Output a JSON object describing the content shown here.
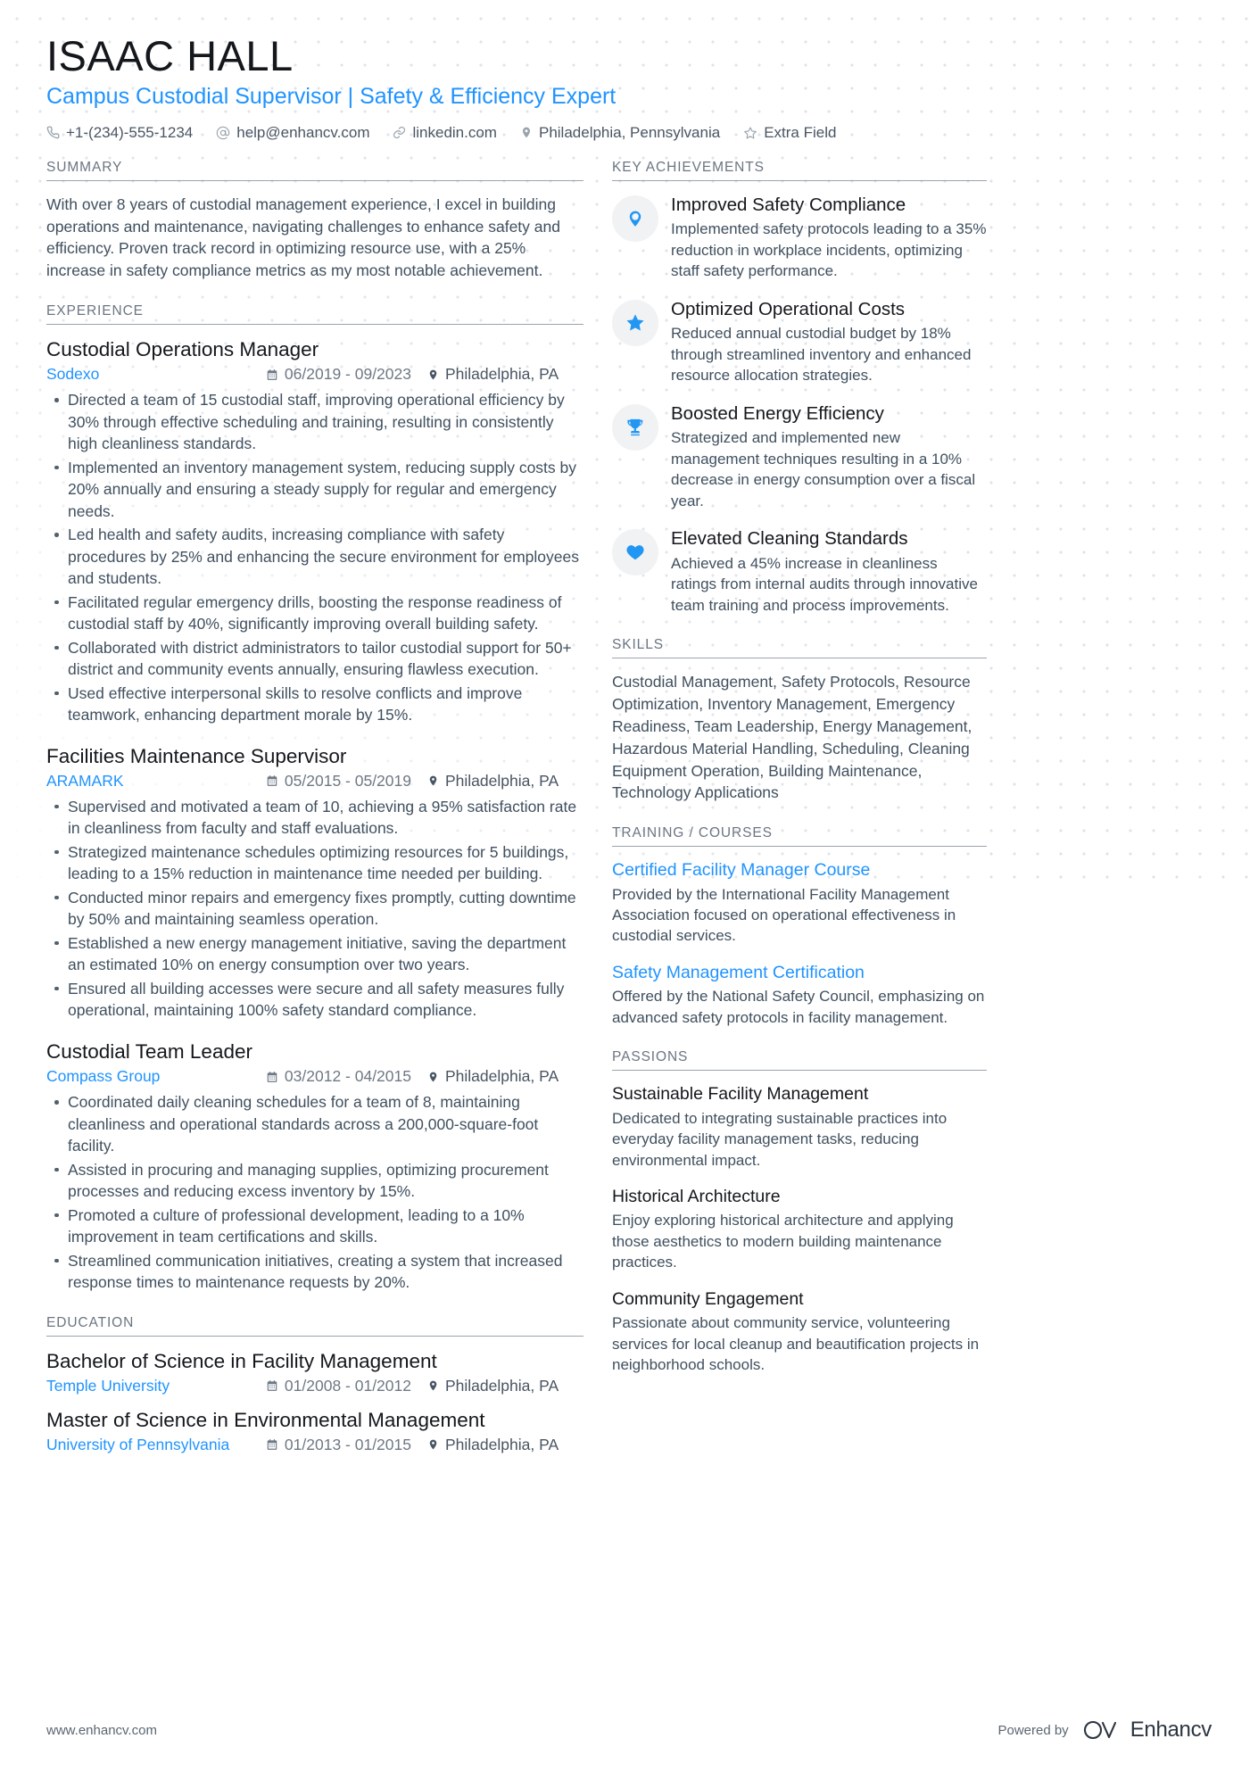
{
  "header": {
    "name": "ISAAC HALL",
    "headline": "Campus Custodial Supervisor | Safety & Efficiency Expert",
    "contacts": [
      {
        "icon": "phone-icon",
        "text": "+1-(234)-555-1234"
      },
      {
        "icon": "at-sign-icon",
        "text": "help@enhancv.com"
      },
      {
        "icon": "link-icon",
        "text": "linkedin.com"
      },
      {
        "icon": "location-pin-icon",
        "text": "Philadelphia, Pennsylvania"
      },
      {
        "icon": "star-outline-icon",
        "text": "Extra Field"
      }
    ]
  },
  "colors": {
    "accent": "#1f93ff",
    "icon_blue": "#2196f3",
    "heading": "#6b7582",
    "text": "#40505f",
    "title": "#14171c"
  },
  "sections": {
    "summary": {
      "title": "SUMMARY",
      "text": "With over 8 years of custodial management experience, I excel in building operations and maintenance, navigating challenges to enhance safety and efficiency. Proven track record in optimizing resource use, with a 25% increase in safety compliance metrics as my most notable achievement."
    },
    "experience": {
      "title": "EXPERIENCE",
      "entries": [
        {
          "title": "Custodial Operations Manager",
          "company": "Sodexo",
          "dates": "06/2019 - 09/2023",
          "location": "Philadelphia, PA",
          "bullets": [
            "Directed a team of 15 custodial staff, improving operational efficiency by 30% through effective scheduling and training, resulting in consistently high cleanliness standards.",
            "Implemented an inventory management system, reducing supply costs by 20% annually and ensuring a steady supply for regular and emergency needs.",
            "Led health and safety audits, increasing compliance with safety procedures by 25% and enhancing the secure environment for employees and students.",
            "Facilitated regular emergency drills, boosting the response readiness of custodial staff by 40%, significantly improving overall building safety.",
            "Collaborated with district administrators to tailor custodial support for 50+ district and community events annually, ensuring flawless execution.",
            "Used effective interpersonal skills to resolve conflicts and improve teamwork, enhancing department morale by 15%."
          ]
        },
        {
          "title": "Facilities Maintenance Supervisor",
          "company": "ARAMARK",
          "dates": "05/2015 - 05/2019",
          "location": "Philadelphia, PA",
          "bullets": [
            "Supervised and motivated a team of 10, achieving a 95% satisfaction rate in cleanliness from faculty and staff evaluations.",
            "Strategized maintenance schedules optimizing resources for 5 buildings, leading to a 15% reduction in maintenance time needed per building.",
            "Conducted minor repairs and emergency fixes promptly, cutting downtime by 50% and maintaining seamless operation.",
            "Established a new energy management initiative, saving the department an estimated 10% on energy consumption over two years.",
            "Ensured all building accesses were secure and all safety measures fully operational, maintaining 100% safety standard compliance."
          ]
        },
        {
          "title": "Custodial Team Leader",
          "company": "Compass Group",
          "dates": "03/2012 - 04/2015",
          "location": "Philadelphia, PA",
          "bullets": [
            "Coordinated daily cleaning schedules for a team of 8, maintaining cleanliness and operational standards across a 200,000-square-foot facility.",
            "Assisted in procuring and managing supplies, optimizing procurement processes and reducing excess inventory by 15%.",
            "Promoted a culture of professional development, leading to a 10% improvement in team certifications and skills.",
            "Streamlined communication initiatives, creating a system that increased response times to maintenance requests by 20%."
          ]
        }
      ]
    },
    "education": {
      "title": "EDUCATION",
      "entries": [
        {
          "title": "Bachelor of Science in Facility Management",
          "school": "Temple University",
          "dates": "01/2008 - 01/2012",
          "location": "Philadelphia, PA"
        },
        {
          "title": "Master of Science in Environmental Management",
          "school": "University of Pennsylvania",
          "dates": "01/2013 - 01/2015",
          "location": "Philadelphia, PA"
        }
      ]
    },
    "key_achievements": {
      "title": "KEY ACHIEVEMENTS",
      "items": [
        {
          "icon": "map-pin-icon",
          "title": "Improved Safety Compliance",
          "desc": "Implemented safety protocols leading to a 35% reduction in workplace incidents, optimizing staff safety performance."
        },
        {
          "icon": "star-icon",
          "title": "Optimized Operational Costs",
          "desc": "Reduced annual custodial budget by 18% through streamlined inventory and enhanced resource allocation strategies."
        },
        {
          "icon": "trophy-icon",
          "title": "Boosted Energy Efficiency",
          "desc": "Strategized and implemented new management techniques resulting in a 10% decrease in energy consumption over a fiscal year."
        },
        {
          "icon": "heart-icon",
          "title": "Elevated Cleaning Standards",
          "desc": "Achieved a 45% increase in cleanliness ratings from internal audits through innovative team training and process improvements."
        }
      ]
    },
    "skills": {
      "title": "SKILLS",
      "text": "Custodial Management, Safety Protocols, Resource Optimization, Inventory Management, Emergency Readiness, Team Leadership, Energy Management, Hazardous Material Handling, Scheduling, Cleaning Equipment Operation, Building Maintenance, Technology Applications"
    },
    "training": {
      "title": "TRAINING / COURSES",
      "items": [
        {
          "title": "Certified Facility Manager Course",
          "desc": "Provided by the International Facility Management Association focused on operational effectiveness in custodial services."
        },
        {
          "title": "Safety Management Certification",
          "desc": "Offered by the National Safety Council, emphasizing on advanced safety protocols in facility management."
        }
      ]
    },
    "passions": {
      "title": "PASSIONS",
      "items": [
        {
          "title": "Sustainable Facility Management",
          "desc": "Dedicated to integrating sustainable practices into everyday facility management tasks, reducing environmental impact."
        },
        {
          "title": "Historical Architecture",
          "desc": "Enjoy exploring historical architecture and applying those aesthetics to modern building maintenance practices."
        },
        {
          "title": "Community Engagement",
          "desc": "Passionate about community service, volunteering services for local cleanup and beautification projects in neighborhood schools."
        }
      ]
    }
  },
  "footer": {
    "url": "www.enhancv.com",
    "powered_by": "Powered by",
    "brand": "Enhancv"
  }
}
